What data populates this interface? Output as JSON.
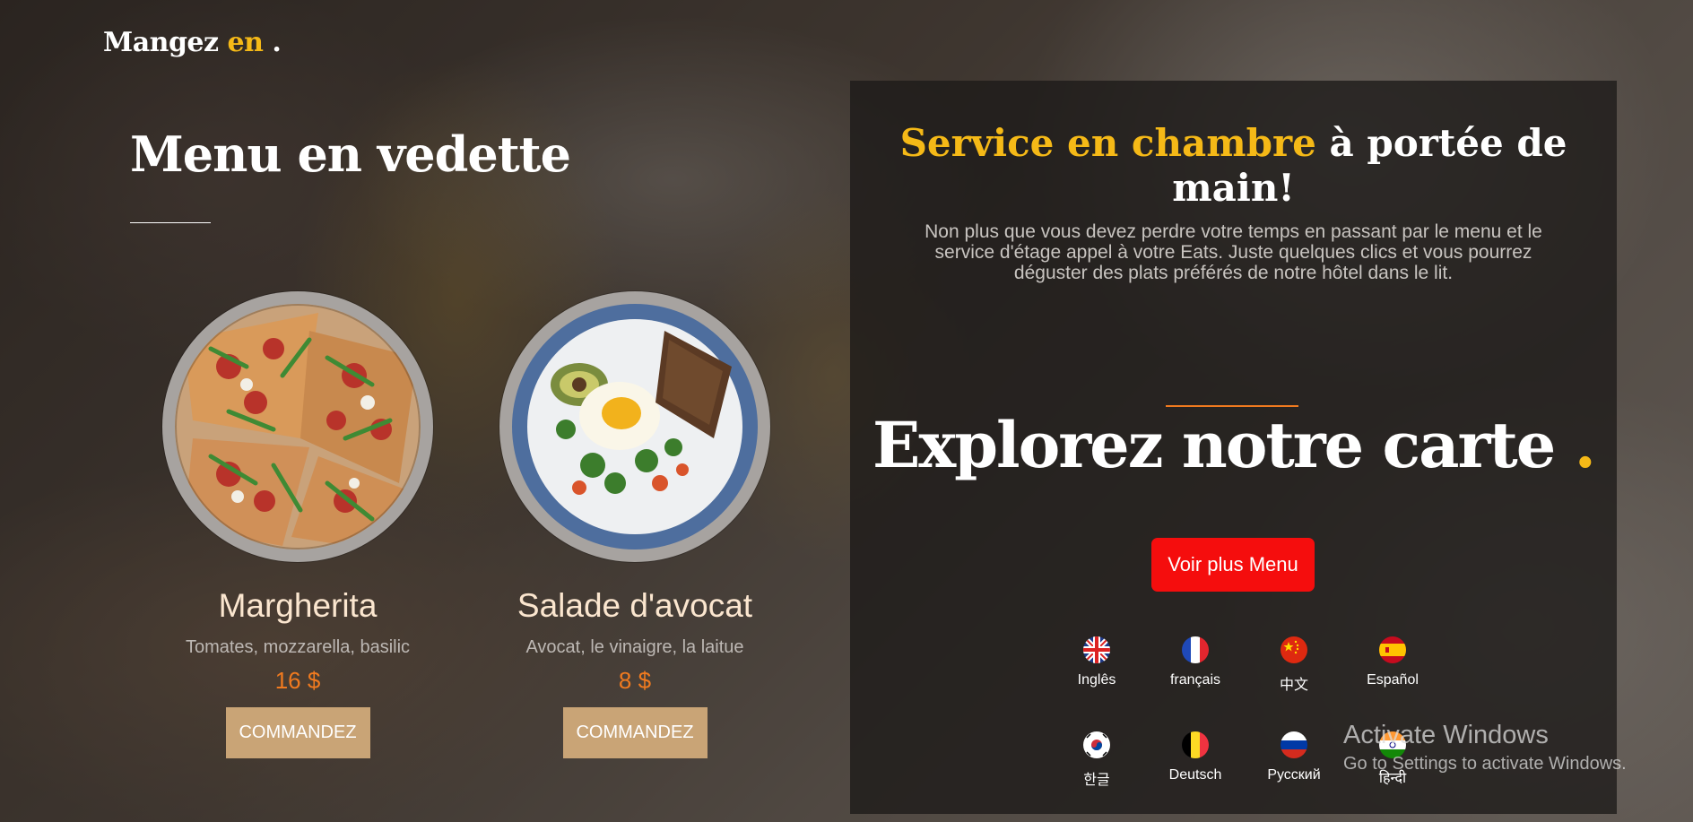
{
  "logo": {
    "text": "Mangez ",
    "accent": "en",
    "dot": " ."
  },
  "featured": {
    "title": "Menu en vedette",
    "items": [
      {
        "name": "Margherita",
        "desc": "Tomates, mozzarella, basilic",
        "price": "16 $",
        "button": "COMMANDEZ"
      },
      {
        "name": "Salade d'avocat",
        "desc": "Avocat, le vinaigre, la laitue",
        "price": "8 $",
        "button": "COMMANDEZ"
      }
    ]
  },
  "panel": {
    "title_accent": "Service en chambre",
    "title_rest": " à portée de main!",
    "text": "Non plus que vous devez perdre votre temps en passant par le menu et le service d'étage appel à votre Eats. Juste quelques clics et vous pourrez déguster des plats préférés de notre hôtel dans le lit.",
    "explore": "Explorez notre carte ",
    "explore_dot": ".",
    "more_button": "Voir plus Menu"
  },
  "languages": [
    {
      "label": "Inglês",
      "flag": "uk-flag-icon"
    },
    {
      "label": "français",
      "flag": "france-flag-icon"
    },
    {
      "label": "中文",
      "flag": "china-flag-icon"
    },
    {
      "label": "Español",
      "flag": "spain-flag-icon"
    },
    {
      "label": "한글",
      "flag": "korea-flag-icon"
    },
    {
      "label": "Deutsch",
      "flag": "belgium-flag-icon"
    },
    {
      "label": "Русский",
      "flag": "russia-flag-icon"
    },
    {
      "label": "हिन्दी",
      "flag": "india-flag-icon"
    }
  ],
  "watermark": {
    "title": "Activate Windows",
    "subtitle": "Go to Settings to activate Windows."
  },
  "colors": {
    "accent_yellow": "#f5b917",
    "accent_orange": "#f07a1f",
    "button_red": "#f50d0d",
    "order_tan": "#c9a476"
  }
}
